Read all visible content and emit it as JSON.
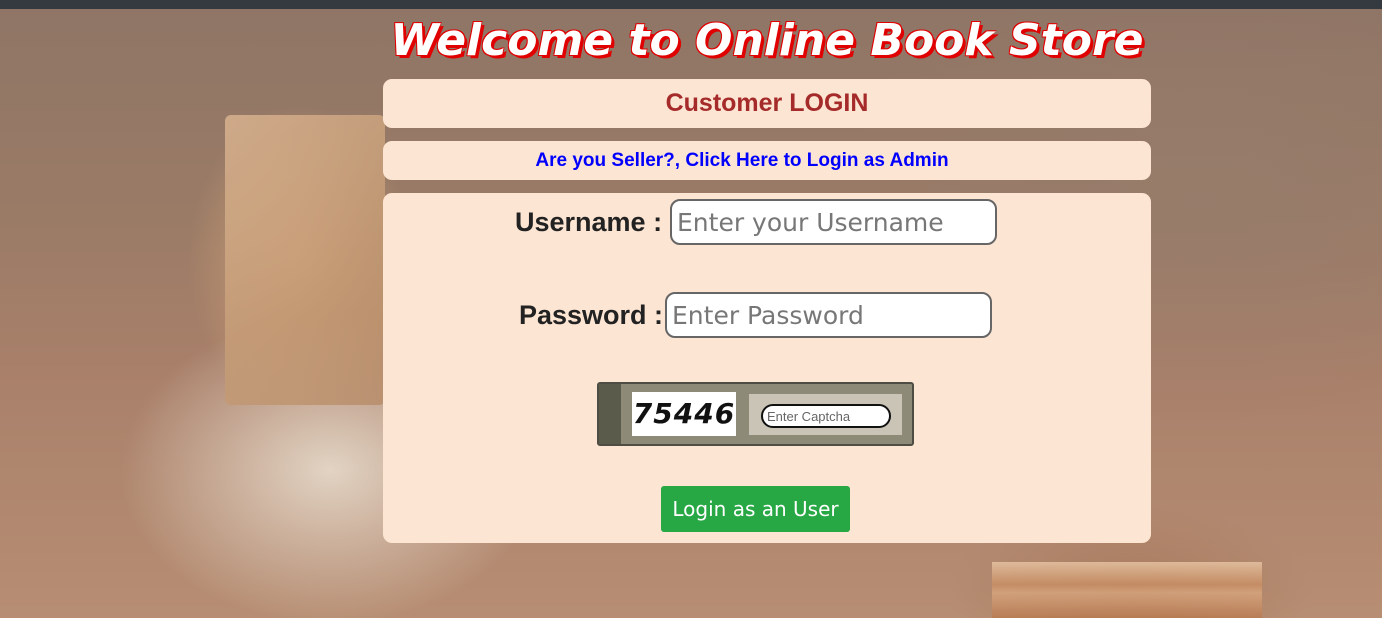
{
  "header": {
    "welcome_title": "Welcome to Online Book Store"
  },
  "login": {
    "title": "Customer LOGIN",
    "seller_link": "Are you Seller?, Click Here to Login as Admin",
    "username_label": "Username :",
    "username_placeholder": "Enter your Username",
    "password_label": "Password :",
    "password_placeholder": "Enter Password",
    "captcha_code": "75446",
    "captcha_placeholder": "Enter Captcha",
    "submit_label": "Login as an User"
  },
  "colors": {
    "panel_bg": "#fde5d3",
    "title_color": "#a52a2a",
    "link_color": "#0000ff",
    "button_bg": "#28a745",
    "welcome_shadow": "#e00000"
  }
}
